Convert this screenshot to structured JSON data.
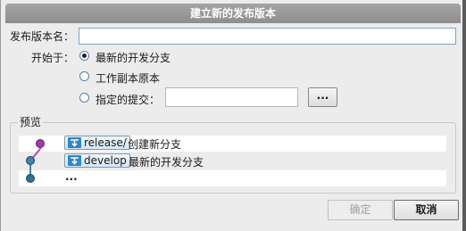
{
  "dialog": {
    "title": "建立新的发布版本"
  },
  "form": {
    "release_name_label": "发布版本名：",
    "release_name_value": "",
    "start_from_label": "开始于：",
    "options": [
      {
        "label": "最新的开发分支",
        "selected": true
      },
      {
        "label": "工作副本原本",
        "selected": false
      },
      {
        "label": "指定的提交：",
        "selected": false
      }
    ],
    "commit_value": "",
    "browse_button": "..."
  },
  "preview": {
    "title": "预览",
    "rows": [
      {
        "badge": "release/",
        "text": "创建新分支",
        "node_color": "#a23bab"
      },
      {
        "badge": "develop",
        "text": "最新的开发分支",
        "node_color": "#3f86a8"
      },
      {
        "badge": "",
        "text": "...",
        "node_color": "#2f6f8f"
      }
    ]
  },
  "buttons": {
    "ok": "确定",
    "cancel": "取消"
  },
  "colors": {
    "release_line": "#b04cc0",
    "develop_line": "#3f86a8",
    "title_bg": "#999999"
  }
}
